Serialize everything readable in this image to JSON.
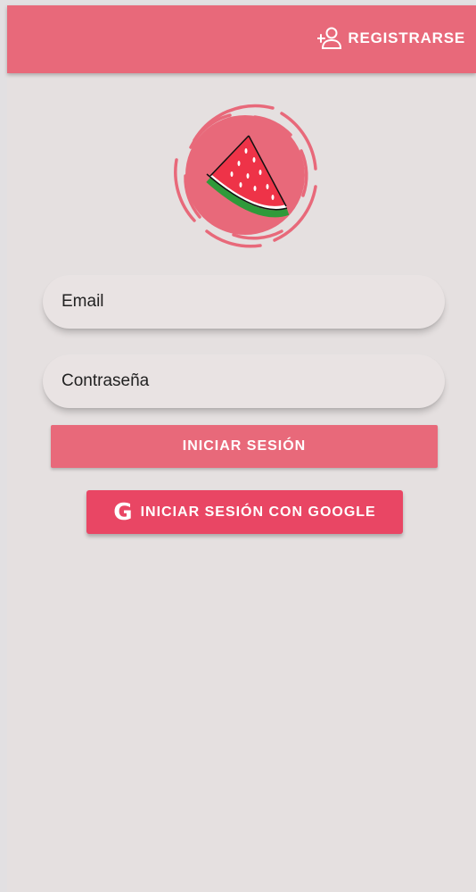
{
  "appbar": {
    "register_label": "REGISTRARSE",
    "register_icon": "person-add-icon",
    "color": "#e8697a"
  },
  "logo": {
    "icon": "watermelon-icon",
    "circle_color": "#e8697a"
  },
  "form": {
    "email_placeholder": "Email",
    "password_placeholder": "Contraseña",
    "login_label": "INICIAR SESIÓN",
    "google_label": "INICIAR SESIÓN CON GOOGLE",
    "google_icon_glyph": "G",
    "google_color": "#e94664"
  }
}
